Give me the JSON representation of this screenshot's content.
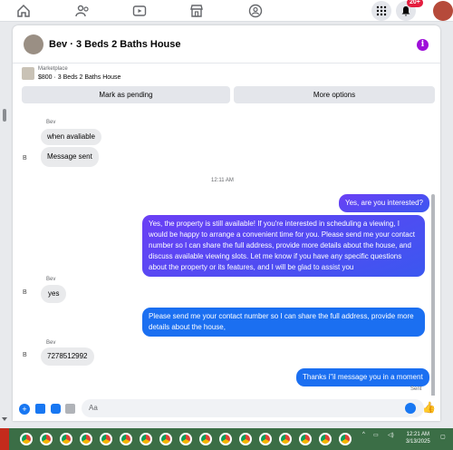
{
  "topnav": {
    "notification_count": "20+"
  },
  "header": {
    "title": "Bev · 3 Beds 2 Baths House"
  },
  "listing": {
    "label": "Marketplace",
    "title": "$800 · 3 Beds 2 Baths House",
    "mark_pending": "Mark as pending",
    "more_options": "More options"
  },
  "messages": {
    "sender1": "Bev",
    "msg1": "when avaliable",
    "msg2": "Message sent",
    "avatar_alt": "B",
    "timestamp": "12:11 AM",
    "out1": "Yes, are you interested?",
    "out2": "Yes, the property is still available! If you're interested in scheduling a viewing, I would be happy to arrange a convenient time for you. Please send me your contact number so I can share the full address, provide more details about the house, and discuss available viewing slots. Let me know if you have any specific questions about the property or its features, and I will be glad to assist you",
    "sender2": "Bev",
    "in3": "yes",
    "out3": "Please send me your contact number so I can share the full address, provide more details about the house,",
    "sender3": "Bev",
    "in4": "7278512992",
    "out4": "Thanks i\"il message you in a moment",
    "status": "Sent"
  },
  "compose": {
    "placeholder": "Aa"
  },
  "taskbar": {
    "time": "12:21 AM",
    "date": "3/13/2025"
  },
  "colors": {
    "accent": "#1877f2",
    "outgoing_gradient_start": "#6b3ff5",
    "outgoing_gradient_end": "#3b57f0",
    "info": "#9e0fd9"
  }
}
